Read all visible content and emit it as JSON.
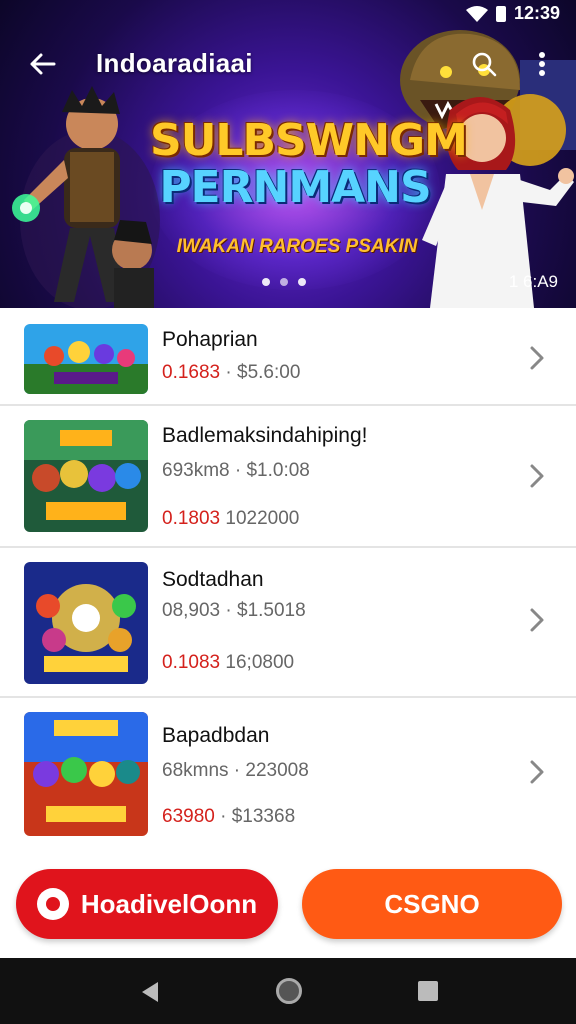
{
  "status_bar": {
    "time": "12:39"
  },
  "toolbar": {
    "title": "Indoaradiaai"
  },
  "banner": {
    "title_line1": "SULBSWNGM",
    "title_line2": "PERNMANS",
    "subtitle": "IWAKAN RAROES PSAKIN",
    "counter": "1 6:A9",
    "page_dots": 3
  },
  "items": [
    {
      "title": "Pohaprian",
      "row1_red": "0.1683",
      "row1_rest": "· $5.6:00",
      "row2_red": "",
      "row2_rest": ""
    },
    {
      "title": "Badlemaksindahiping!",
      "row1_red": "",
      "row1_rest": "693km8 · $1.0:08",
      "row2_red": "0.1803",
      "row2_rest": "1022000"
    },
    {
      "title": "Sodtadhan",
      "row1_red": "",
      "row1_rest": "08,903 · $1.5018",
      "row2_red": "0.1083",
      "row2_rest": "16;0800"
    },
    {
      "title": "Bapadbdan",
      "row1_red": "",
      "row1_rest": "68kmns · 223008",
      "row2_red": "63980",
      "row2_rest": "· $13368"
    }
  ],
  "buttons": {
    "left_label": "HoadivelOonn",
    "right_label": "CSGNO"
  },
  "colors": {
    "primary_red": "#e0141c",
    "primary_orange": "#ff5a14",
    "price_red": "#d4211c"
  }
}
